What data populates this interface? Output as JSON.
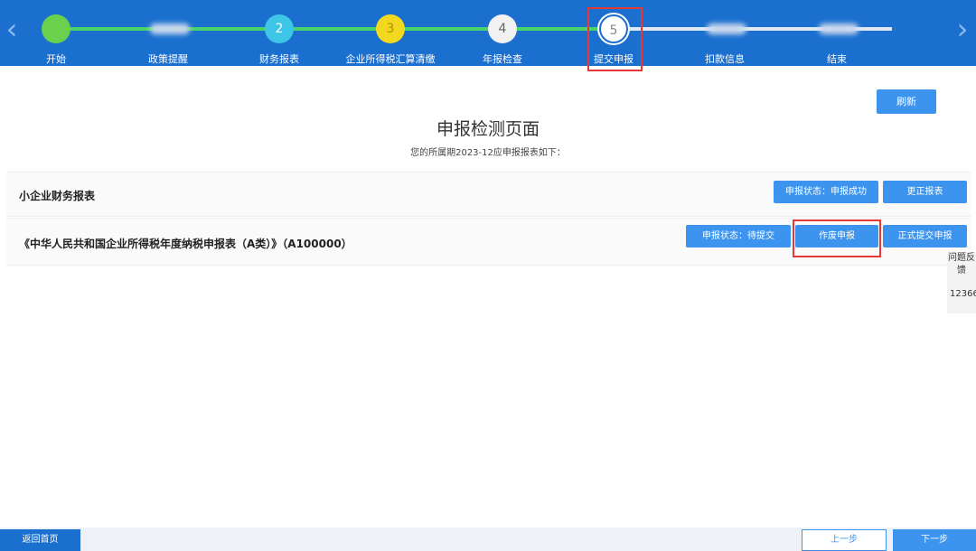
{
  "steps": [
    {
      "label": "开始",
      "num": "",
      "state": "done"
    },
    {
      "label": "政策提醒",
      "num": "",
      "state": "blurred"
    },
    {
      "label": "财务报表",
      "num": "2",
      "state": "teal"
    },
    {
      "label": "企业所得税汇算清缴",
      "num": "3",
      "state": "yellow"
    },
    {
      "label": "年报检查",
      "num": "4",
      "state": "white"
    },
    {
      "label": "提交申报",
      "num": "5",
      "state": "current"
    },
    {
      "label": "扣款信息",
      "num": "",
      "state": "blurred"
    },
    {
      "label": "结束",
      "num": "",
      "state": "blurred"
    }
  ],
  "nav": {
    "prev_symbol": "‹",
    "next_symbol": "›"
  },
  "header": {
    "refresh_label": "刷新",
    "title": "申报检测页面",
    "subtitle": "您的所属期2023-12应申报报表如下："
  },
  "reports": [
    {
      "name": "小企业财务报表",
      "status": "申报状态：申报成功",
      "action": "更正报表"
    },
    {
      "name": "《中华人民共和国企业所得税年度纳税申报表（A类）》（A100000）",
      "status": "申报状态：待提交",
      "void_label": "作废申报",
      "submit_label": "正式提交申报"
    }
  ],
  "side": {
    "feedback": "问题反馈",
    "hotline": "12366"
  },
  "footer": {
    "home_label": "返回首页",
    "prev_label": "上一步",
    "next_label": "下一步"
  },
  "colors": {
    "bar": "#1b6fcf",
    "button": "#3d94ee",
    "highlight": "#e53935",
    "done": "#4cd26a"
  }
}
